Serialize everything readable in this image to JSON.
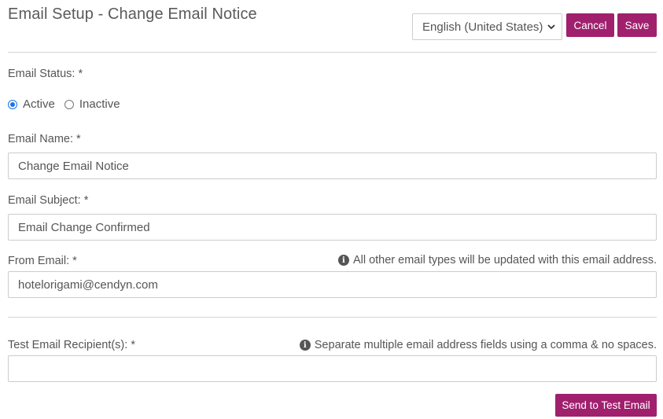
{
  "header": {
    "title": "Email Setup - Change Email Notice",
    "language_select": {
      "selected": "English (United States)"
    },
    "cancel_label": "Cancel",
    "save_label": "Save"
  },
  "form": {
    "status": {
      "label": "Email Status: *",
      "options": [
        {
          "label": "Active",
          "checked": true
        },
        {
          "label": "Inactive",
          "checked": false
        }
      ]
    },
    "email_name": {
      "label": "Email Name: *",
      "value": "Change Email Notice"
    },
    "email_subject": {
      "label": "Email Subject: *",
      "value": "Email Change Confirmed"
    },
    "from_email": {
      "label": "From Email: *",
      "hint": "All other email types will be updated with this email address.",
      "value": "hotelorigami@cendyn.com"
    },
    "test_recipients": {
      "label": "Test Email Recipient(s): *",
      "hint": "Separate multiple email address fields using a comma & no spaces.",
      "value": ""
    },
    "send_test_label": "Send to Test Email"
  },
  "colors": {
    "accent": "#a0206e",
    "radio_selected": "#1a73e8"
  }
}
